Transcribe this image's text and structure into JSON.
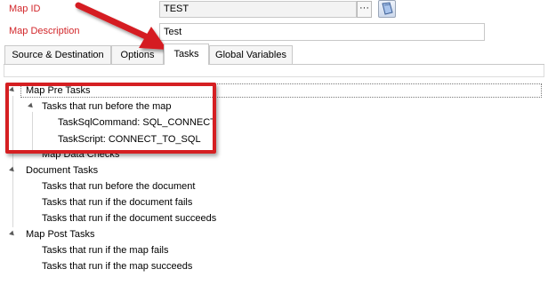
{
  "form": {
    "map_id_label": "Map ID",
    "map_id_value": "TEST",
    "ellipsis_label": "···",
    "map_description_label": "Map Description",
    "map_description_value": "Test"
  },
  "tabs": [
    {
      "label": "Source & Destination",
      "active": false
    },
    {
      "label": "Options",
      "active": false
    },
    {
      "label": "Tasks",
      "active": true
    },
    {
      "label": "Global Variables",
      "active": false
    }
  ],
  "tree": {
    "map_pre_tasks": "Map Pre Tasks",
    "tasks_before_map": "Tasks that run before the map",
    "task_sql_command": "TaskSqlCommand: SQL_CONNECT",
    "task_script": "TaskScript: CONNECT_TO_SQL",
    "map_data_checks": "Map Data Checks",
    "document_tasks": "Document Tasks",
    "tasks_before_document": "Tasks that run before the document",
    "tasks_document_fails": "Tasks that run if the document fails",
    "tasks_document_succeeds": "Tasks that run if the document succeeds",
    "map_post_tasks": "Map Post Tasks",
    "tasks_map_fails": "Tasks that run if the map fails",
    "tasks_map_succeeds": "Tasks that run if the map succeeds"
  },
  "colors": {
    "label_red": "#d2262a",
    "annotation_red": "#d51f22"
  },
  "icons": {
    "book_button": "book-icon",
    "expander": "expand-triangle-icon",
    "annotation_arrow": "red-arrow-icon"
  }
}
